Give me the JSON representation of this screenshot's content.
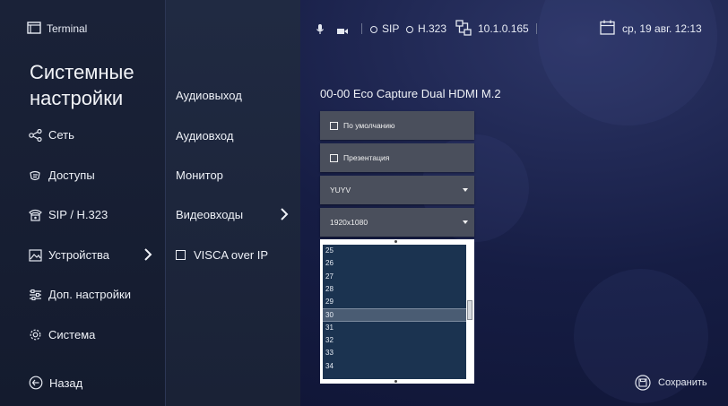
{
  "topbar": {
    "app_name": "Terminal",
    "sip_label": "SIP",
    "h323_label": "H.323",
    "ip_address": "10.1.0.165",
    "datetime": "ср, 19 авг. 12:13"
  },
  "page_title_line1": "Системные",
  "page_title_line2": "настройки",
  "sidebar": {
    "items": [
      {
        "label": "Сеть",
        "icon": "share-icon"
      },
      {
        "label": "Доступы",
        "icon": "access-icon"
      },
      {
        "label": "SIP / H.323",
        "icon": "phone-icon"
      },
      {
        "label": "Устройства",
        "icon": "image-icon"
      },
      {
        "label": "Доп. настройки",
        "icon": "sliders-icon"
      },
      {
        "label": "Система",
        "icon": "gear-icon"
      }
    ],
    "back_label": "Назад"
  },
  "submenu": {
    "items": [
      {
        "label": "Аудиовыход"
      },
      {
        "label": "Аудиовход"
      },
      {
        "label": "Монитор"
      },
      {
        "label": "Видеовходы"
      },
      {
        "label": "VISCA over IP"
      }
    ]
  },
  "device": {
    "title": "00-00 Eco Capture Dual HDMI M.2",
    "default_label": "По умолчанию",
    "presentation_label": "Презентация",
    "format_value": "YUYV",
    "resolution_value": "1920x1080",
    "fps_options": [
      "25",
      "26",
      "27",
      "28",
      "29",
      "30",
      "31",
      "32",
      "33",
      "34"
    ],
    "fps_selected": "30"
  },
  "save_label": "Сохранить",
  "colors": {
    "background": "#161d44",
    "sidebar": "#1a2238",
    "field": "#4a4f5c",
    "list_bg": "#1b3350",
    "list_selected": "#4a5c73"
  }
}
